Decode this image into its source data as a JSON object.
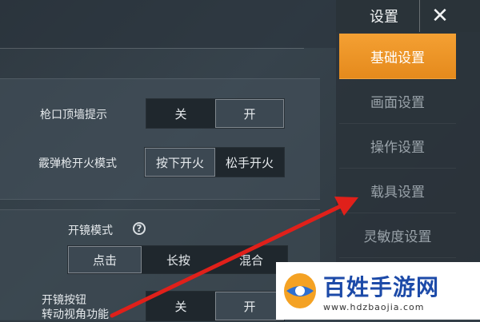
{
  "panel": {
    "header_title": "设置",
    "close_label": "✕"
  },
  "nav": {
    "items": [
      {
        "label": "基础设置",
        "active": true
      },
      {
        "label": "画面设置",
        "active": false
      },
      {
        "label": "操作设置",
        "active": false
      },
      {
        "label": "载具设置",
        "active": false
      },
      {
        "label": "灵敏度设置",
        "active": false
      }
    ]
  },
  "settings": {
    "muzzle_hint": {
      "label": "枪口顶墙提示",
      "options": [
        "关",
        "开"
      ],
      "selected": "开"
    },
    "shotgun_fire": {
      "label": "霰弹枪开火模式",
      "options": [
        "按下开火",
        "松手开火"
      ],
      "selected": "按下开火"
    },
    "scope_mode": {
      "label": "开镜模式",
      "help": "?",
      "options": [
        "点击",
        "长按",
        "混合"
      ],
      "selected": "点击"
    },
    "scope_button": {
      "label_line1": "开镜按钮",
      "label_line2": "转动视角功能",
      "options": [
        "关",
        "开"
      ],
      "selected": "开"
    }
  },
  "watermark": {
    "text": "百姓手游网",
    "url": "www.hdzbaojia.com"
  },
  "colors": {
    "accent": "#f09a2c",
    "arrow": "#e0201a"
  }
}
